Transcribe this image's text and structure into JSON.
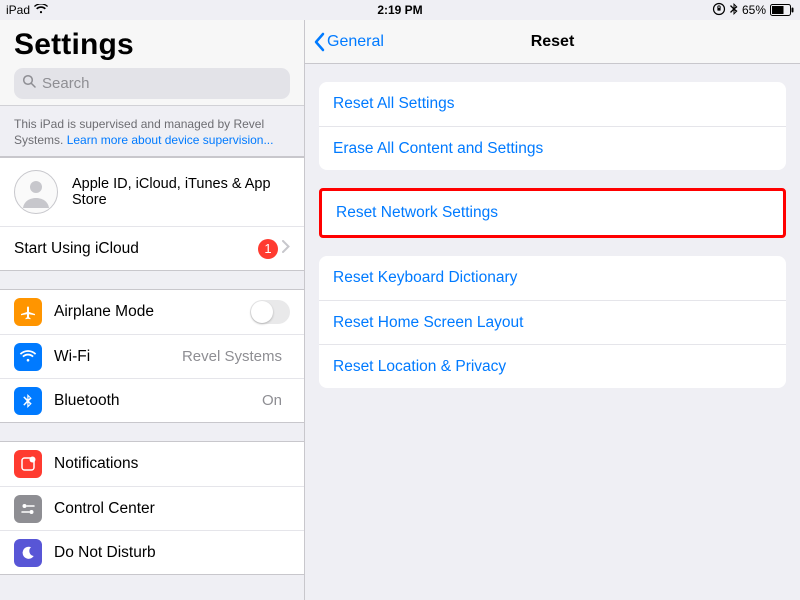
{
  "status": {
    "device": "iPad",
    "time": "2:19 PM",
    "battery_percent": "65%"
  },
  "sidebar": {
    "title": "Settings",
    "search_placeholder": "Search",
    "supervised": {
      "text": "This iPad is supervised and managed by Revel Systems.",
      "link": "Learn more about device supervision..."
    },
    "account": {
      "label": "Apple ID, iCloud, iTunes & App Store",
      "icloud_label": "Start Using iCloud",
      "badge": "1"
    },
    "rows": {
      "airplane": "Airplane Mode",
      "wifi": "Wi-Fi",
      "wifi_value": "Revel Systems",
      "bluetooth": "Bluetooth",
      "bluetooth_value": "On",
      "notifications": "Notifications",
      "control_center": "Control Center",
      "dnd": "Do Not Disturb"
    }
  },
  "main": {
    "back_label": "General",
    "title": "Reset",
    "options": {
      "reset_all": "Reset All Settings",
      "erase_all": "Erase All Content and Settings",
      "reset_network": "Reset Network Settings",
      "reset_keyboard": "Reset Keyboard Dictionary",
      "reset_home": "Reset Home Screen Layout",
      "reset_location": "Reset Location & Privacy"
    }
  }
}
